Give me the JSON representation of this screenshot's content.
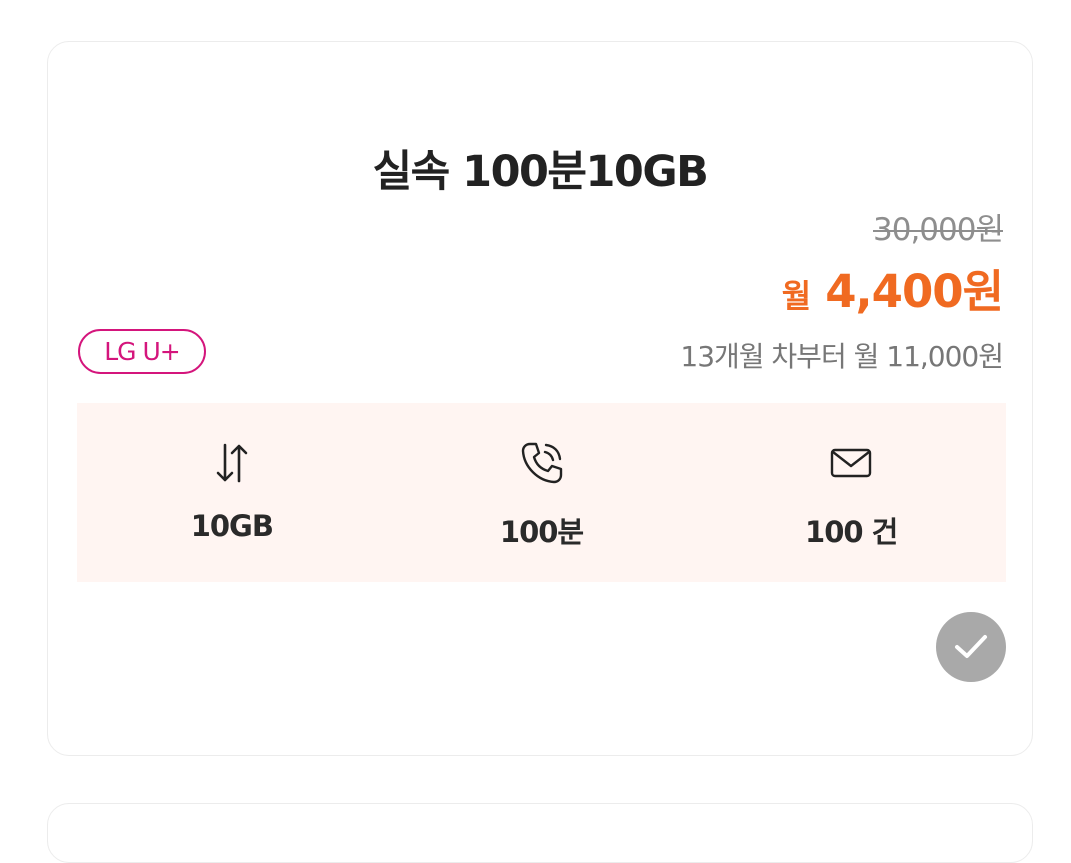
{
  "plan": {
    "title": "실속 100분10GB",
    "original_price": "30,000원",
    "sale_prefix": "월",
    "sale_price": "4,400원",
    "after_price": "13개월 차부터 월 11,000원",
    "carrier": "LG U+",
    "features": [
      {
        "icon": "data-transfer-icon",
        "value": "10GB"
      },
      {
        "icon": "phone-call-icon",
        "value": "100분"
      },
      {
        "icon": "mail-icon",
        "value": "100 건"
      }
    ],
    "selected_icon": "check-icon"
  },
  "colors": {
    "accent": "#f06a21",
    "carrier": "#d4157c",
    "feature_bg": "#fff5f2",
    "check_bg": "#a9a9a9"
  }
}
